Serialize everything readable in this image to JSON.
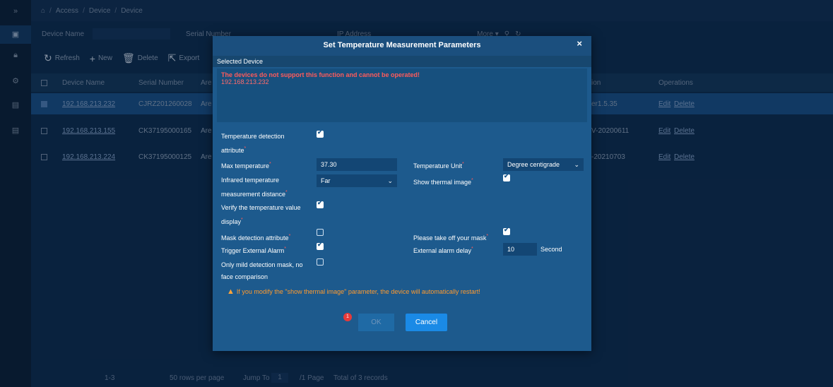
{
  "breadcrumb": {
    "home_icon": "home-icon",
    "items": [
      "Access",
      "Device",
      "Device"
    ],
    "sep": "/"
  },
  "rail": {
    "expand": "»",
    "icons": [
      "monitor-icon",
      "lock-icon",
      "gear-icon",
      "document-icon",
      "document-icon"
    ]
  },
  "filter": {
    "device_name_label": "Device Name",
    "serial_label": "Serial Number",
    "ip_label": "IP Address",
    "more": "More ▾"
  },
  "toolbar": {
    "refresh": "Refresh",
    "new": "New",
    "delete": "Delete",
    "export": "Export"
  },
  "table": {
    "headers": {
      "name": "Device Name",
      "serial": "Serial Number",
      "area": "Are",
      "version": "ion",
      "ops": "Operations"
    },
    "rows": [
      {
        "name": "192.168.213.232",
        "serial": "CJRZ201260028",
        "area": "Are",
        "version": "er1.5.35",
        "edit": "Edit",
        "delete": "Delete",
        "selected": true
      },
      {
        "name": "192.168.213.155",
        "serial": "CK37195000165",
        "area": "Are",
        "version": "V-20200611",
        "edit": "Edit",
        "delete": "Delete",
        "selected": false
      },
      {
        "name": "192.168.213.224",
        "serial": "CK37195000125",
        "area": "Are",
        "version": "-20210703",
        "edit": "Edit",
        "delete": "Delete",
        "selected": false
      }
    ]
  },
  "pager": {
    "range": "1-3",
    "rows_per_page": "50 rows per page",
    "jump_to": "Jump To",
    "page_value": "1",
    "page_total": "/1 Page",
    "total": "Total of 3 records"
  },
  "modal": {
    "title": "Set Temperature Measurement Parameters",
    "close": "×",
    "selected_device_header": "Selected Device",
    "error_title": "The devices do not support this function and cannot be operated!",
    "error_ip": "192.168.213.232",
    "labels": {
      "temp_detection_1": "Temperature detection",
      "temp_detection_2": "attribute",
      "max_temp": "Max temperature",
      "temp_unit": "Temperature Unit",
      "ir_distance_1": "Infrared temperature",
      "ir_distance_2": "measurement distance",
      "show_thermal": "Show thermal image",
      "verify_1": "Verify the temperature value",
      "verify_2": "display",
      "mask_detection": "Mask detection attribute",
      "take_off_mask": "Please take off your mask",
      "trigger_alarm": "Trigger External Alarm",
      "alarm_delay": "External alarm delay",
      "mild_mask_1": "Only mild detection mask, no",
      "mild_mask_2": "face comparison"
    },
    "values": {
      "max_temp": "37.30",
      "temp_unit": "Degree centigrade",
      "ir_distance": "Far",
      "alarm_delay": "10",
      "alarm_delay_unit": "Second"
    },
    "checks": {
      "temp_detection": true,
      "show_thermal": true,
      "verify": true,
      "mask_detection": false,
      "take_off_mask": true,
      "trigger_alarm": true,
      "mild_mask": false
    },
    "warning": "If you modify the \"show thermal image\" parameter, the device will automatically restart!",
    "ok": "OK",
    "cancel": "Cancel",
    "badge": "1",
    "colors": {
      "ok_bg": "#1f6aa5",
      "cancel_bg": "#1a8ae6",
      "error": "#ff5b5b",
      "warning": "#ff9a2e"
    }
  }
}
